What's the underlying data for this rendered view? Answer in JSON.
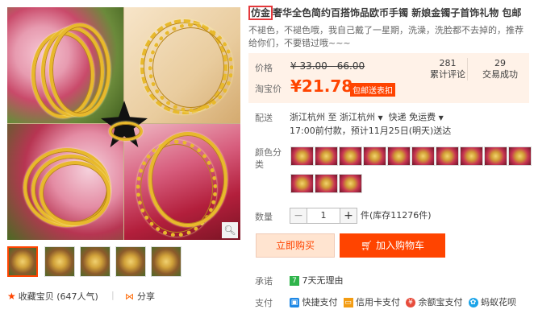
{
  "title": {
    "highlight": "仿金",
    "rest": "奢华全色简约百搭饰品欧币手镯 新娘金镯子首饰礼物 包邮"
  },
  "subtitle": "不褪色，不褪色哦，我自己戴了一星期，洗澡，洗脸都不去掉的，推荐给你们，不要错过哦~~~",
  "price": {
    "label": "价格",
    "original": "¥ 33.00 - 66.00",
    "taobao_label": "淘宝价",
    "current": "¥21.78",
    "promo": "包邮送表扣"
  },
  "stats": [
    {
      "value": "281",
      "label": "累计评论"
    },
    {
      "value": "29",
      "label": "交易成功"
    }
  ],
  "shipping": {
    "label": "配送",
    "route_from": "浙江杭州",
    "to": "至",
    "route_to": "浙江杭州",
    "carrier": "快递 免运费",
    "note": "17:00前付款，预计11月25日(明天)送达"
  },
  "color": {
    "label": "颜色分类",
    "swatch_count": 14
  },
  "quantity": {
    "label": "数量",
    "value": "1",
    "stock": "件(库存11276件)"
  },
  "buttons": {
    "buy_now": "立即购买",
    "add_cart": "加入购物车"
  },
  "promise": {
    "label": "承诺",
    "text": "7天无理由",
    "badge": "7"
  },
  "payment": {
    "label": "支付",
    "methods": [
      "快捷支付",
      "信用卡支付",
      "余额宝支付",
      "蚂蚁花呗"
    ]
  },
  "favorite": {
    "text": "收藏宝贝 (647人气)"
  },
  "share": {
    "text": "分享"
  },
  "accent": "#ff4400"
}
